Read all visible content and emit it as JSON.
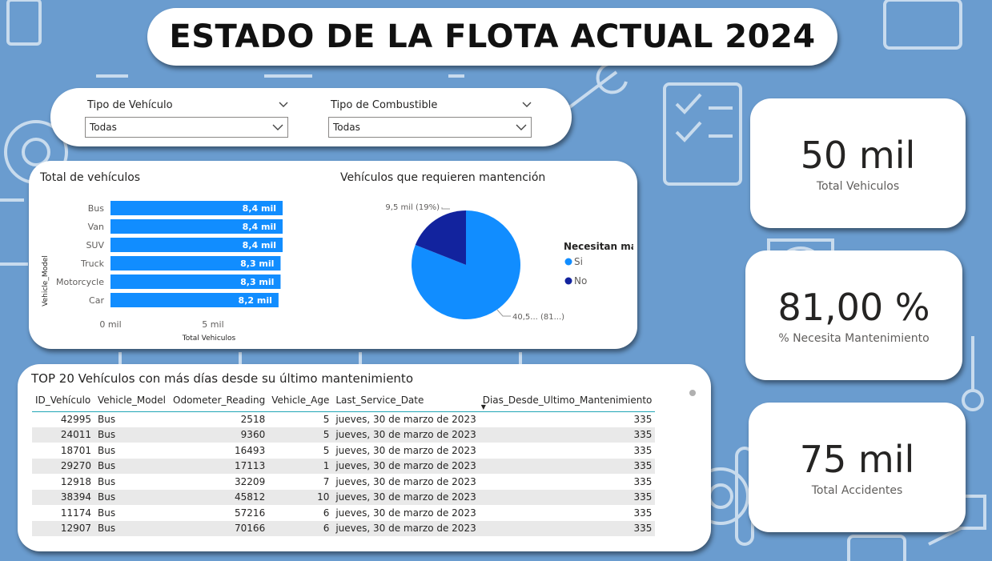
{
  "report": {
    "title": "ESTADO DE LA FLOTA ACTUAL 2024"
  },
  "filters": [
    {
      "label": "Tipo de Vehículo",
      "value": "Todas"
    },
    {
      "label": "Tipo de Combustible",
      "value": "Todas"
    }
  ],
  "colors": {
    "background": "#6a9ccf",
    "bar": "#118dff",
    "pie_si": "#118dff",
    "pie_no": "#12239e",
    "accent_line": "#21a6b6"
  },
  "bar_chart": {
    "title": "Total de vehículos",
    "y_axis_title": "Vehicle_Model",
    "x_axis_title": "Total Vehiculos",
    "x_ticks": [
      "0 mil",
      "5 mil"
    ]
  },
  "pie_chart": {
    "title": "Vehículos que requieren mantención",
    "legend_title": "Necesitan mante...",
    "label_no": "9,5 mil (19%)",
    "label_si": "40,5... (81...)"
  },
  "chart_data": [
    {
      "type": "bar",
      "orientation": "horizontal",
      "title": "Total de vehículos",
      "xlabel": "Total Vehiculos",
      "ylabel": "Vehicle_Model",
      "categories": [
        "Bus",
        "Van",
        "SUV",
        "Truck",
        "Motorcycle",
        "Car"
      ],
      "values": [
        8400,
        8400,
        8400,
        8300,
        8300,
        8200
      ],
      "data_labels": [
        "8,4 mil",
        "8,4 mil",
        "8,4 mil",
        "8,3 mil",
        "8,3 mil",
        "8,2 mil"
      ],
      "xlim": [
        0,
        8400
      ]
    },
    {
      "type": "pie",
      "title": "Vehículos que requieren mantención",
      "legend_title": "Necesitan mante...",
      "legend_position": "right",
      "categories": [
        "Si",
        "No"
      ],
      "values": [
        40500,
        9500
      ],
      "percent": [
        81,
        19
      ],
      "data_labels": [
        "40,5... (81...)",
        "9,5 mil (19%)"
      ]
    }
  ],
  "kpis": [
    {
      "value": "50 mil",
      "label": "Total Vehiculos"
    },
    {
      "value": "81,00 %",
      "label": "% Necesita Mantenimiento"
    },
    {
      "value": "75 mil",
      "label": "Total Accidentes"
    }
  ],
  "table": {
    "title": "TOP 20 Vehículos con más días desde su último mantenimiento",
    "columns": [
      "ID_Vehículo",
      "Vehicle_Model",
      "Odometer_Reading",
      "Vehicle_Age",
      "Last_Service_Date",
      "Dias_Desde_Ultimo_Mantenimiento"
    ],
    "rows": [
      [
        "42995",
        "Bus",
        "2518",
        "5",
        "jueves, 30 de marzo de 2023",
        "335"
      ],
      [
        "24011",
        "Bus",
        "9360",
        "5",
        "jueves, 30 de marzo de 2023",
        "335"
      ],
      [
        "18701",
        "Bus",
        "16493",
        "5",
        "jueves, 30 de marzo de 2023",
        "335"
      ],
      [
        "29270",
        "Bus",
        "17113",
        "1",
        "jueves, 30 de marzo de 2023",
        "335"
      ],
      [
        "12918",
        "Bus",
        "32209",
        "7",
        "jueves, 30 de marzo de 2023",
        "335"
      ],
      [
        "38394",
        "Bus",
        "45812",
        "10",
        "jueves, 30 de marzo de 2023",
        "335"
      ],
      [
        "11174",
        "Bus",
        "57216",
        "6",
        "jueves, 30 de marzo de 2023",
        "335"
      ],
      [
        "12907",
        "Bus",
        "70166",
        "6",
        "jueves, 30 de marzo de 2023",
        "335"
      ]
    ]
  }
}
